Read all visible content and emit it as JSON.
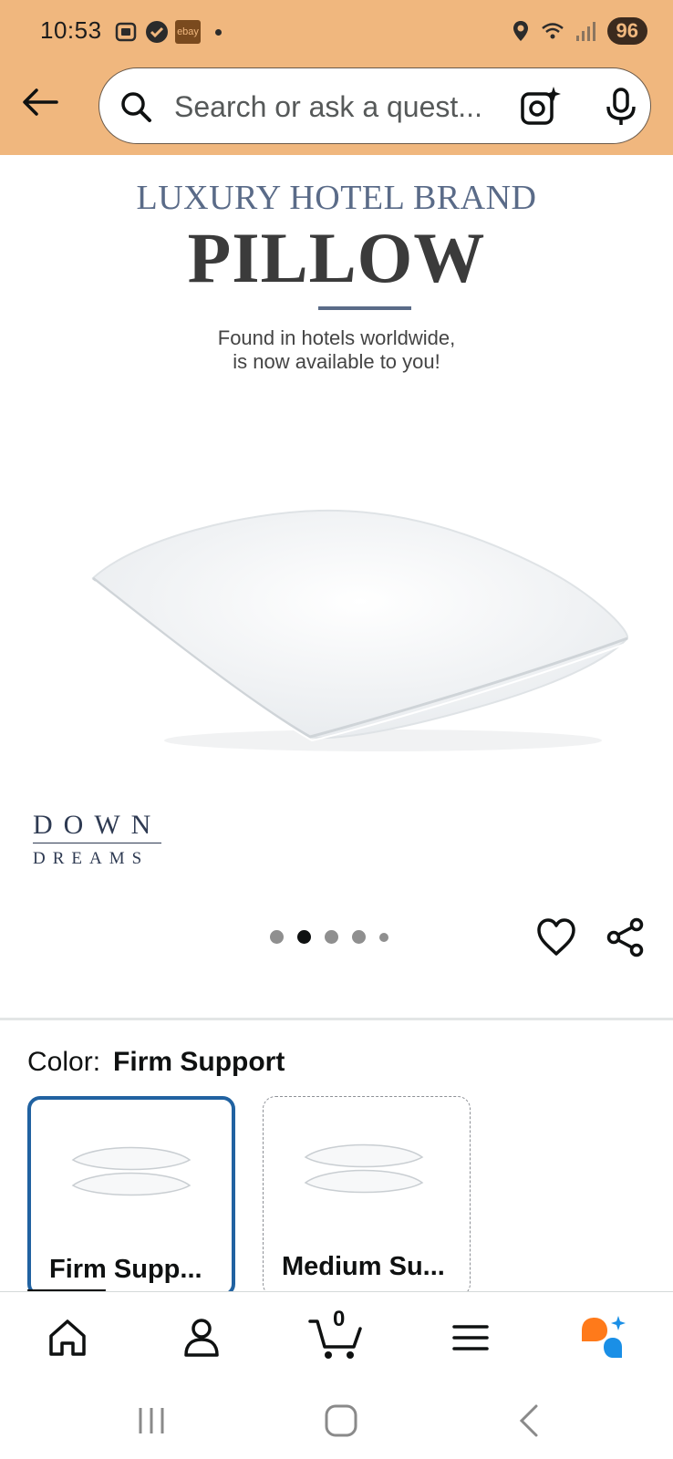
{
  "status_bar": {
    "time": "10:53",
    "ebay_label": "ebay",
    "battery": "96"
  },
  "search": {
    "placeholder": "Search or ask a quest..."
  },
  "product_image": {
    "promo_subtitle": "LUXURY HOTEL BRAND",
    "promo_title": "PILLOW",
    "promo_line1": "Found in hotels worldwide,",
    "promo_line2": "is now available to you!",
    "brand_line1": "DOWN",
    "brand_line2": "DREAMS",
    "carousel_total": 5,
    "carousel_active_index": 1
  },
  "color_selector": {
    "label": "Color:",
    "selected_value": "Firm Support",
    "options": [
      {
        "label": "Firm Supp...",
        "selected": true
      },
      {
        "label": "Medium Su...",
        "selected": false
      }
    ]
  },
  "bottom_nav": {
    "cart_count": "0",
    "items": [
      "home-icon",
      "account-icon",
      "cart-icon",
      "menu-icon",
      "rufus-icon"
    ]
  },
  "colors": {
    "header_bg": "#f0b77e",
    "selected_border": "#2162a1",
    "rufus_orange": "#ff7a1a",
    "rufus_blue": "#1a8fe6"
  }
}
